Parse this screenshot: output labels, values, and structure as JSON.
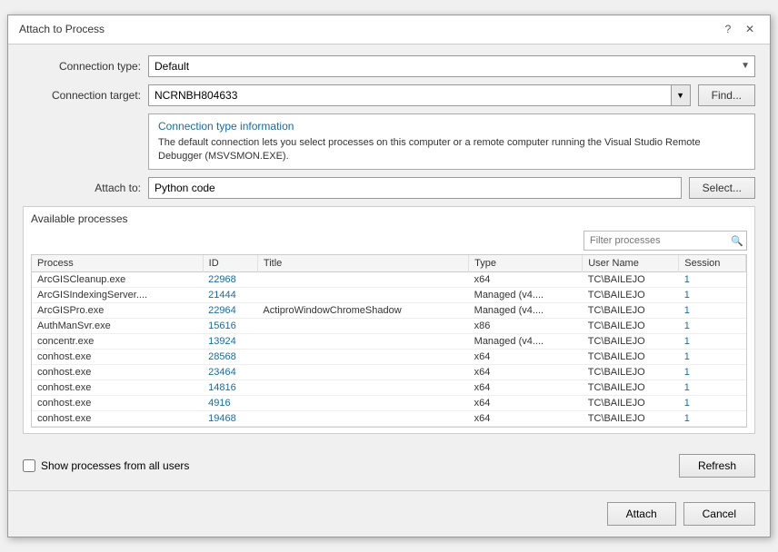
{
  "dialog": {
    "title": "Attach to Process",
    "help_btn": "?",
    "close_btn": "✕"
  },
  "form": {
    "connection_type_label": "Connection type:",
    "connection_type_value": "Default",
    "connection_target_label": "Connection target:",
    "connection_target_value": "NCRNBH804633",
    "find_btn": "Find...",
    "info_title": "Connection type information",
    "info_text": "The default connection lets you select processes on this computer or a remote computer running the Visual Studio Remote Debugger (MSVSMON.EXE).",
    "attach_to_label": "Attach to:",
    "attach_to_value": "Python code",
    "select_btn": "Select..."
  },
  "processes": {
    "section_label": "Available processes",
    "filter_placeholder": "Filter processes",
    "columns": [
      "Process",
      "ID",
      "Title",
      "Type",
      "User Name",
      "Session"
    ],
    "rows": [
      {
        "process": "ArcGISCleanup.exe",
        "id": "22968",
        "title": "",
        "type": "x64",
        "user": "TC\\BAILEJO",
        "session": "1"
      },
      {
        "process": "ArcGISIndexingServer....",
        "id": "21444",
        "title": "",
        "type": "Managed (v4....",
        "user": "TC\\BAILEJO",
        "session": "1"
      },
      {
        "process": "ArcGISPro.exe",
        "id": "22964",
        "title": "ActiproWindowChromeShadow",
        "type": "Managed (v4....",
        "user": "TC\\BAILEJO",
        "session": "1"
      },
      {
        "process": "AuthManSvr.exe",
        "id": "15616",
        "title": "",
        "type": "x86",
        "user": "TC\\BAILEJO",
        "session": "1"
      },
      {
        "process": "concentr.exe",
        "id": "13924",
        "title": "",
        "type": "Managed (v4....",
        "user": "TC\\BAILEJO",
        "session": "1"
      },
      {
        "process": "conhost.exe",
        "id": "28568",
        "title": "",
        "type": "x64",
        "user": "TC\\BAILEJO",
        "session": "1"
      },
      {
        "process": "conhost.exe",
        "id": "23464",
        "title": "",
        "type": "x64",
        "user": "TC\\BAILEJO",
        "session": "1"
      },
      {
        "process": "conhost.exe",
        "id": "14816",
        "title": "",
        "type": "x64",
        "user": "TC\\BAILEJO",
        "session": "1"
      },
      {
        "process": "conhost.exe",
        "id": "4916",
        "title": "",
        "type": "x64",
        "user": "TC\\BAILEJO",
        "session": "1"
      },
      {
        "process": "conhost.exe",
        "id": "19468",
        "title": "",
        "type": "x64",
        "user": "TC\\BAILEJO",
        "session": "1"
      }
    ],
    "show_all_label": "Show processes from all users",
    "refresh_btn": "Refresh"
  },
  "footer": {
    "attach_btn": "Attach",
    "cancel_btn": "Cancel"
  }
}
